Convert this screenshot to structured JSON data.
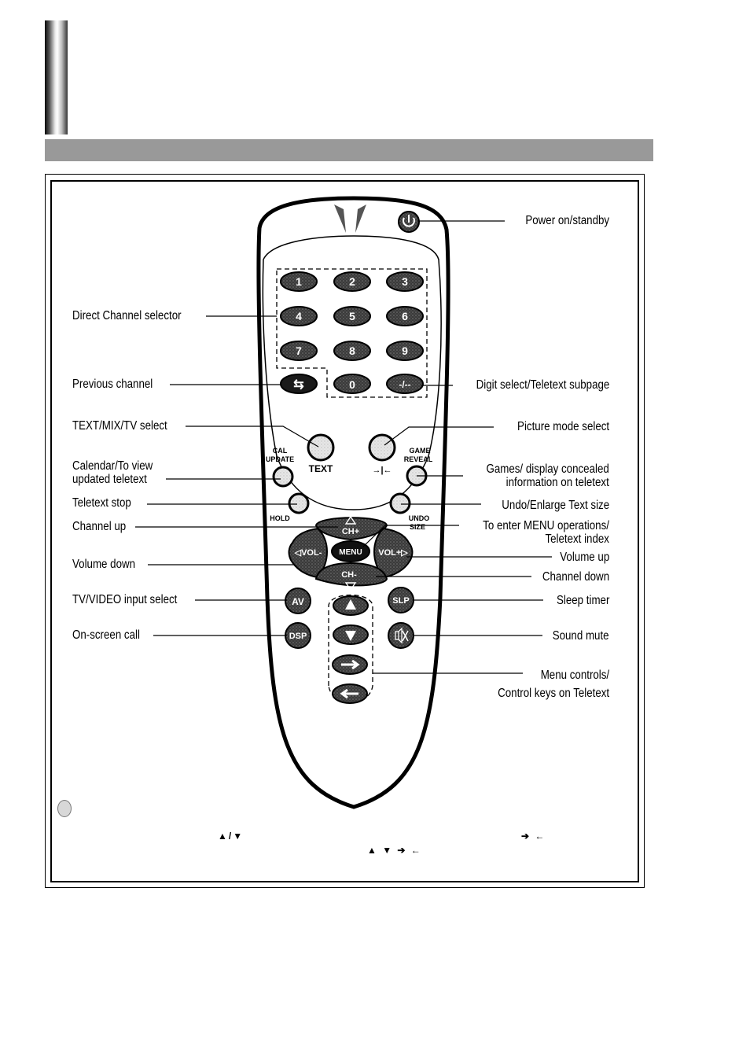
{
  "page": {
    "header_band_color": "#999999",
    "accent_gray": "#999999"
  },
  "remote": {
    "keypad": [
      "1",
      "2",
      "3",
      "4",
      "5",
      "6",
      "7",
      "8",
      "9"
    ],
    "bottom_row": {
      "prev": "⇆",
      "zero": "0",
      "digit": "-/--"
    },
    "text_button_caption": "TEXT",
    "picture_button_caption": "→|←",
    "cal_update_caption": [
      "CAL",
      "UPDATE"
    ],
    "game_reveal_caption": [
      "GAME",
      "REVEAL"
    ],
    "hold_caption": "HOLD",
    "undo_size_caption": [
      "UNDO",
      "SIZE"
    ],
    "ch_up": "CH+",
    "ch_down": "CH-",
    "vol_down": "◁VOL-",
    "vol_up": "VOL+▷",
    "menu": "MENU",
    "av": "AV",
    "dsp": "DSP",
    "slp": "SLP",
    "mute_icon": "mute-icon",
    "power_icon": "power-icon"
  },
  "labels": {
    "left": [
      {
        "id": "direct-channel",
        "text": "Direct Channel selector"
      },
      {
        "id": "previous-channel",
        "text": "Previous channel"
      },
      {
        "id": "text-mix-tv",
        "text": "TEXT/MIX/TV select"
      },
      {
        "id": "calendar",
        "text": "Calendar/To view\nupdated teletext"
      },
      {
        "id": "teletext-stop",
        "text": "Teletext stop"
      },
      {
        "id": "channel-up",
        "text": "Channel up"
      },
      {
        "id": "volume-down",
        "text": "Volume down"
      },
      {
        "id": "tv-video",
        "text": "TV/VIDEO input select"
      },
      {
        "id": "on-screen-call",
        "text": "On-screen call"
      }
    ],
    "right": [
      {
        "id": "power",
        "text": "Power on/standby"
      },
      {
        "id": "digit-select",
        "text": "Digit select/Teletext subpage"
      },
      {
        "id": "picture-mode",
        "text": "Picture mode select"
      },
      {
        "id": "games",
        "text": "Games/ display concealed\ninformation on teletext"
      },
      {
        "id": "undo-enlarge",
        "text": "Undo/Enlarge Text size"
      },
      {
        "id": "menu-ops",
        "text": "To enter MENU operations/\nTeletext index"
      },
      {
        "id": "volume-up",
        "text": "Volume up"
      },
      {
        "id": "channel-down",
        "text": "Channel down"
      },
      {
        "id": "sleep-timer",
        "text": "Sleep timer"
      },
      {
        "id": "sound-mute",
        "text": "Sound mute"
      },
      {
        "id": "menu-controls",
        "text": "Menu controls/\nControl keys on Teletext"
      }
    ]
  },
  "notes": {
    "up_down_symbol": "▲/▼",
    "right_left_symbol": "➔ ←",
    "all_symbols": "▲ ▼ ➔ ←"
  }
}
